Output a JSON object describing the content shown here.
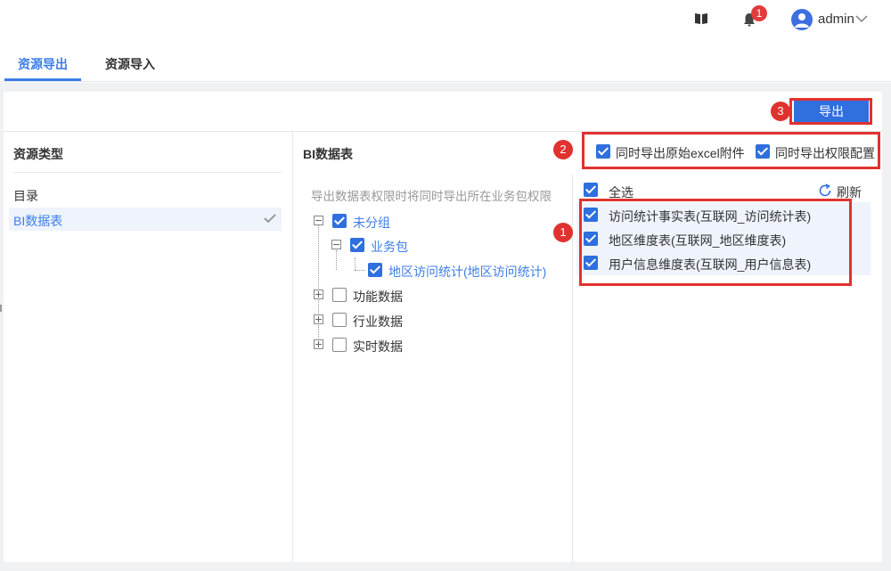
{
  "header": {
    "notifications_count": "1",
    "username": "admin"
  },
  "tabs": [
    {
      "label": "资源导出",
      "active": true
    },
    {
      "label": "资源导入",
      "active": false
    }
  ],
  "toolbar": {
    "export_label": "导出"
  },
  "annotations": [
    "1",
    "2",
    "3"
  ],
  "resource_types": {
    "title": "资源类型",
    "items": [
      {
        "label": "目录",
        "selected": false
      },
      {
        "label": "BI数据表",
        "selected": true
      }
    ]
  },
  "bi_tables": {
    "title": "BI数据表",
    "hint": "导出数据表权限时将同时导出所在业务包权限",
    "tree": [
      {
        "label": "未分组",
        "checked": true,
        "expanded": true
      },
      {
        "label": "业务包",
        "checked": true,
        "expanded": true
      },
      {
        "label": "地区访问统计(地区访问统计)",
        "checked": true
      },
      {
        "label": "功能数据",
        "checked": false,
        "expanded": false
      },
      {
        "label": "行业数据",
        "checked": false,
        "expanded": false
      },
      {
        "label": "实时数据",
        "checked": false,
        "expanded": false
      }
    ]
  },
  "options": {
    "export_excel": {
      "label": "同时导出原始excel附件",
      "checked": true
    },
    "export_permission": {
      "label": "同时导出权限配置",
      "checked": true
    }
  },
  "selection": {
    "select_all_label": "全选",
    "refresh_label": "刷新",
    "tables": [
      {
        "label": "访问统计事实表(互联网_访问统计表)",
        "checked": true
      },
      {
        "label": "地区维度表(互联网_地区维度表)",
        "checked": true
      },
      {
        "label": "用户信息维度表(互联网_用户信息表)",
        "checked": true
      }
    ]
  },
  "colors": {
    "accent": "#3d7ee8",
    "primary_button": "#2f6fde",
    "annotation_red": "#e0322f"
  }
}
